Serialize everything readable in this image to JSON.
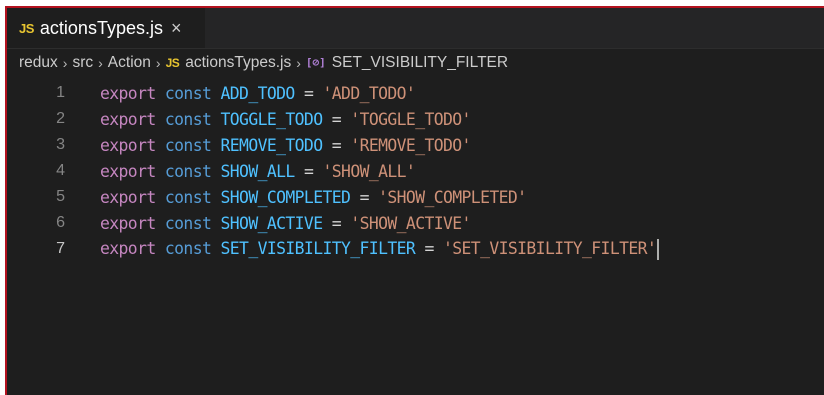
{
  "tab": {
    "icon": "JS",
    "filename": "actionsTypes.js",
    "close_symbol": "×"
  },
  "breadcrumb": {
    "items": [
      "redux",
      "src",
      "Action",
      "actionsTypes.js",
      "SET_VISIBILITY_FILTER"
    ],
    "file_icon": "JS",
    "symbol_icon": "[⊘]",
    "separator": "›"
  },
  "editor": {
    "keywords": {
      "export": "export",
      "const": "const"
    },
    "operator": "=",
    "lines": [
      {
        "number": "1",
        "name": "ADD_TODO",
        "value": "'ADD_TODO'"
      },
      {
        "number": "2",
        "name": "TOGGLE_TODO",
        "value": "'TOGGLE_TODO'"
      },
      {
        "number": "3",
        "name": "REMOVE_TODO",
        "value": "'REMOVE_TODO'"
      },
      {
        "number": "4",
        "name": "SHOW_ALL",
        "value": "'SHOW_ALL'"
      },
      {
        "number": "5",
        "name": "SHOW_COMPLETED",
        "value": "'SHOW_COMPLETED'"
      },
      {
        "number": "6",
        "name": "SHOW_ACTIVE",
        "value": "'SHOW_ACTIVE'"
      },
      {
        "number": "7",
        "name": "SET_VISIBILITY_FILTER",
        "value": "'SET_VISIBILITY_FILTER'"
      }
    ],
    "active_line": "7"
  },
  "colors": {
    "editor_background": "#1e1e1e",
    "keyword_export": "#c586c0",
    "keyword_const": "#569cd6",
    "identifier": "#4fc1ff",
    "string": "#ce9178",
    "js_badge": "#e8c530",
    "frame_border": "#b3121f"
  }
}
